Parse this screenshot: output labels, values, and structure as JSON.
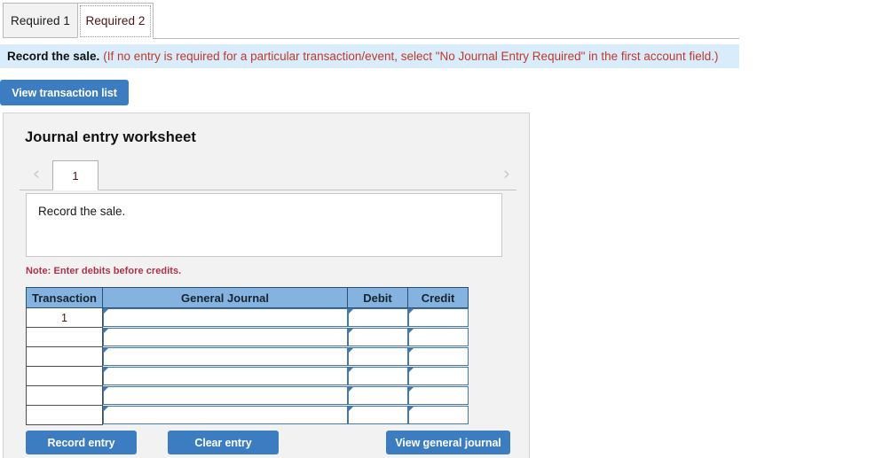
{
  "tabs": [
    {
      "label": "Required 1",
      "active": false
    },
    {
      "label": "Required 2",
      "active": true
    }
  ],
  "instruction": {
    "title": "Record the sale.",
    "hint": "(If no entry is required for a particular transaction/event, select \"No Journal Entry Required\" in the first account field.)"
  },
  "toolbar": {
    "view_transaction_list_label": "View transaction list"
  },
  "worksheet": {
    "title": "Journal entry worksheet",
    "pager": {
      "prev_icon": "chevron-left-icon",
      "next_icon": "chevron-right-icon",
      "prev_glyph": "‹",
      "next_glyph": "›",
      "pages": [
        "1"
      ],
      "active_page": "1"
    },
    "description": "Record the sale.",
    "note": "Note: Enter debits before credits.",
    "table": {
      "columns": [
        "Transaction",
        "General Journal",
        "Debit",
        "Credit"
      ],
      "rows": [
        {
          "transaction": "1",
          "general_journal": "",
          "debit": "",
          "credit": ""
        },
        {
          "transaction": "",
          "general_journal": "",
          "debit": "",
          "credit": ""
        },
        {
          "transaction": "",
          "general_journal": "",
          "debit": "",
          "credit": ""
        },
        {
          "transaction": "",
          "general_journal": "",
          "debit": "",
          "credit": ""
        },
        {
          "transaction": "",
          "general_journal": "",
          "debit": "",
          "credit": ""
        },
        {
          "transaction": "",
          "general_journal": "",
          "debit": "",
          "credit": ""
        }
      ]
    },
    "actions": {
      "record_entry_label": "Record entry",
      "clear_entry_label": "Clear entry",
      "view_general_journal_label": "View general journal"
    }
  },
  "colors": {
    "accent_blue": "#3b7dc0",
    "header_blue": "#85b3e0",
    "instruction_bar_bg": "#d9ecfb",
    "hint_red": "#c0392b",
    "note_red": "#b0304a",
    "panel_bg": "#f2f2f2"
  }
}
